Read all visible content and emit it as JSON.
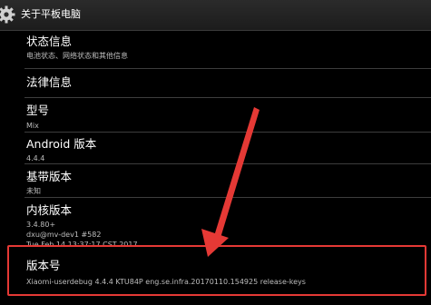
{
  "action_bar": {
    "title": "关于平板电脑",
    "icon": "gear-icon"
  },
  "items": [
    {
      "title": "状态信息",
      "subtitle": "电池状态、网络状态和其他信息"
    },
    {
      "title": "法律信息",
      "subtitle": ""
    },
    {
      "title": "型号",
      "subtitle": "Mix"
    },
    {
      "title": "Android 版本",
      "subtitle": "4.4.4"
    },
    {
      "title": "基带版本",
      "subtitle": "未知"
    },
    {
      "title": "内核版本",
      "lines": [
        "3.4.80+",
        "dxu@mv-dev1 #582",
        "Tue Feb 14 13:37:17 CST 2017"
      ]
    },
    {
      "title": "版本号",
      "subtitle": "Xiaomi-userdebug 4.4.4 KTU84P eng.se.infra.20170110.154925 release-keys"
    }
  ],
  "colors": {
    "background": "#000000",
    "action_bar": "#222222",
    "annotation": "#e53935"
  }
}
